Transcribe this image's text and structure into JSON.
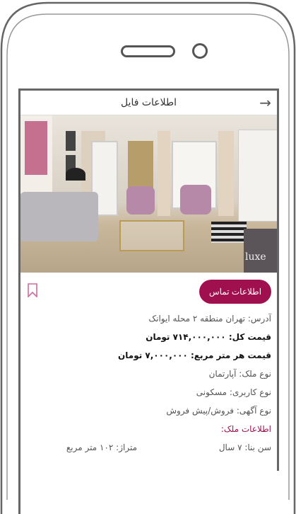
{
  "appbar": {
    "title": "اطلاعات فایل",
    "back_icon": "arrow-right-icon"
  },
  "actions": {
    "contact_label": "اطلاعات تماس",
    "bookmark_icon": "bookmark-icon",
    "accent": "#a0104f"
  },
  "photo": {
    "watermark": "luxe"
  },
  "details": {
    "address": "آدرس: تهران منطقه ۲ محله ایوانک",
    "total_price": "قیمت کل: ۷۱۴,۰۰۰,۰۰۰ تومان",
    "price_per_meter": "قیمت هر متر مربع: ۷,۰۰۰,۰۰۰ تومان",
    "property_type": "نوع ملک: آپارتمان",
    "usage_type": "نوع کاربری: مسکونی",
    "ad_type": "نوع آگهی: فروش/پیش فروش",
    "section_title": "اطلاعات ملک:",
    "building_age": "سن بنا: ۷ سال",
    "area": "متراژ: ۱۰۲ متر مربع"
  }
}
